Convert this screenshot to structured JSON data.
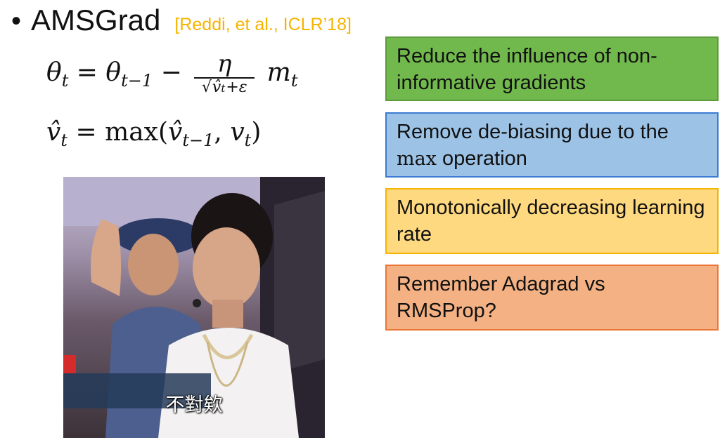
{
  "slide": {
    "bullet": "•",
    "title": "AMSGrad",
    "citation": "[Reddi, et al., ICLR’18]",
    "citation_color": "#f5b400"
  },
  "equations": {
    "eq1": {
      "lhs": "θ",
      "lhs_sub": "t",
      "equals": "=",
      "rhs_var": "θ",
      "rhs_sub": "t−1",
      "minus": "−",
      "numerator": "η",
      "denominator_root": "v̂",
      "denominator_root_sub": "t",
      "denominator_plus": "+ε",
      "tail_var": "m",
      "tail_sub": "t"
    },
    "eq2": {
      "lhs": "v̂",
      "lhs_sub": "t",
      "equals": "=",
      "func": "max(",
      "arg1": "v̂",
      "arg1_sub": "t−1",
      "comma": ",",
      "arg2": "v",
      "arg2_sub": "t",
      "close": ")"
    }
  },
  "photo": {
    "subtitle": "不對欸"
  },
  "boxes": [
    {
      "text": "Reduce the influence of non-informative gradients",
      "color": "#72b94d"
    },
    {
      "text_before": "Remove de-biasing due to the",
      "max_word": "max",
      "text_after": " operation",
      "color": "#9cc2e5"
    },
    {
      "text": "Monotonically decreasing learning rate",
      "color": "#ffd97f"
    },
    {
      "text": "Remember Adagrad vs RMSProp?",
      "color": "#f4b183"
    }
  ]
}
